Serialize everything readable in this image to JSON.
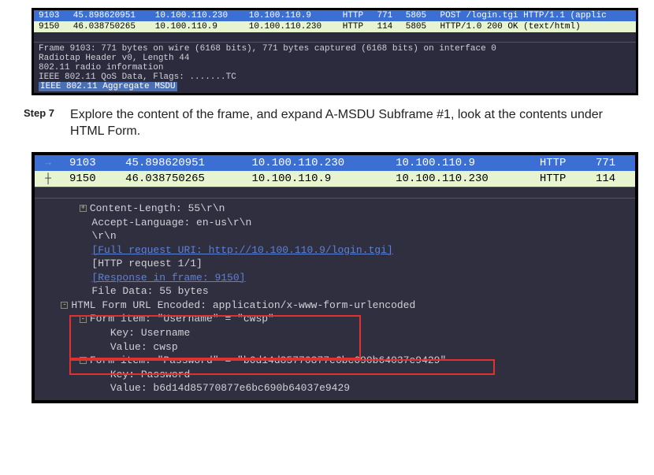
{
  "panel1": {
    "rows": [
      {
        "no": "9103",
        "time": "45.898620951",
        "src": "10.100.110.230",
        "dst": "10.100.110.9",
        "proto": "HTTP",
        "len": "771",
        "port": "5805",
        "info": "POST /login.tgi HTTP/1.1  (applic"
      },
      {
        "no": "9150",
        "time": "46.038750265",
        "src": "10.100.110.9",
        "dst": "10.100.110.230",
        "proto": "HTTP",
        "len": "114",
        "port": "5805",
        "info": "HTTP/1.0 200 OK  (text/html)"
      }
    ],
    "details": [
      "Frame 9103: 771 bytes on wire (6168 bits), 771 bytes captured (6168 bits) on interface 0",
      "Radiotap Header v0, Length 44",
      "802.11 radio information",
      "IEEE 802.11 QoS Data, Flags: .......TC",
      "IEEE 802.11 Aggregate MSDU"
    ]
  },
  "step": {
    "label": "Step 7",
    "text": "Explore the content of the frame, and expand A-MSDU Subframe #1, look at the contents under HTML Form."
  },
  "panel2": {
    "rows": [
      {
        "no": "9103",
        "time": "45.898620951",
        "src": "10.100.110.230",
        "dst": "10.100.110.9",
        "proto": "HTTP",
        "len": "771"
      },
      {
        "no": "9150",
        "time": "46.038750265",
        "src": "10.100.110.9",
        "dst": "10.100.110.230",
        "proto": "HTTP",
        "len": "114"
      }
    ],
    "details": {
      "content_length": "Content-Length: 55\\r\\n",
      "accept_lang": "Accept-Language: en-us\\r\\n",
      "crlf": "\\r\\n",
      "full_uri": "[Full request URI: http://10.100.110.9/login.tgi]",
      "http_req": "[HTTP request 1/1]",
      "resp_frame": "[Response in frame: 9150]",
      "file_data": "File Data: 55 bytes",
      "form_header": "HTML Form URL Encoded: application/x-www-form-urlencoded",
      "form_item_user": "Form item: \"Username\" = \"cwsp\"",
      "key_user": "Key: Username",
      "val_user": "Value: cwsp",
      "form_item_pass": "Form item: \"Password\" = \"b6d14d85770877e6bc690b64037e9429\"",
      "key_pass": "Key: Password",
      "val_pass": "Value: b6d14d85770877e6bc690b64037e9429"
    }
  }
}
